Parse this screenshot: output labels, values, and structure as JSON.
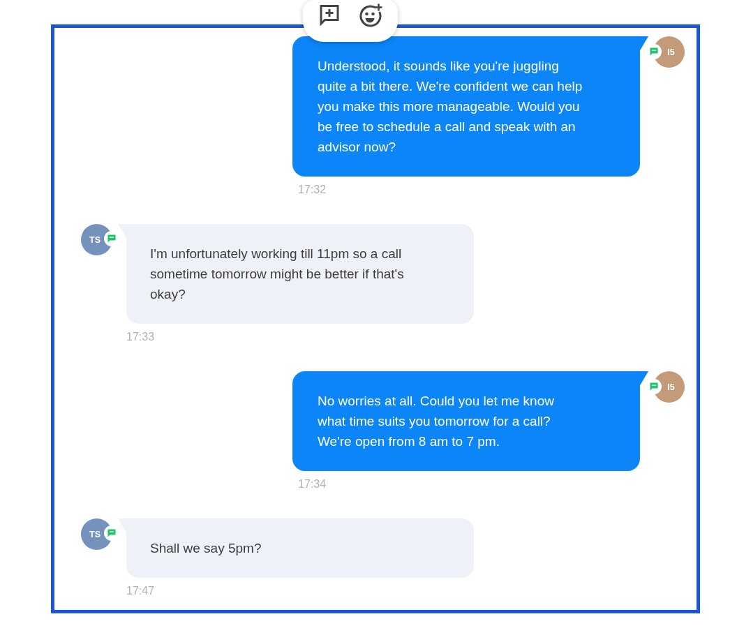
{
  "messages": [
    {
      "kind": "outgoing",
      "avatar": {
        "initials": "I5",
        "color": "#c49b78"
      },
      "text": "Understood, it sounds like you're juggling quite a bit there. We're confident we can help you make this more manageable. Would you be free to schedule a call and speak with an advisor now?",
      "time": "17:32"
    },
    {
      "kind": "incoming",
      "avatar": {
        "initials": "TS",
        "color": "#7592bd"
      },
      "text": "I'm unfortunately working till 11pm so a call sometime tomorrow might be better if that's okay?",
      "time": "17:33"
    },
    {
      "kind": "outgoing",
      "avatar": {
        "initials": "I5",
        "color": "#c49b78"
      },
      "text": "No worries at all. Could you let me know\nwhat time suits you tomorrow for a call?\nWe're open from 8 am to 7 pm.",
      "time": "17:34"
    },
    {
      "kind": "incoming",
      "avatar": {
        "initials": "TS",
        "color": "#7592bd"
      },
      "text": "Shall we say 5pm?",
      "time": "17:47"
    }
  ]
}
